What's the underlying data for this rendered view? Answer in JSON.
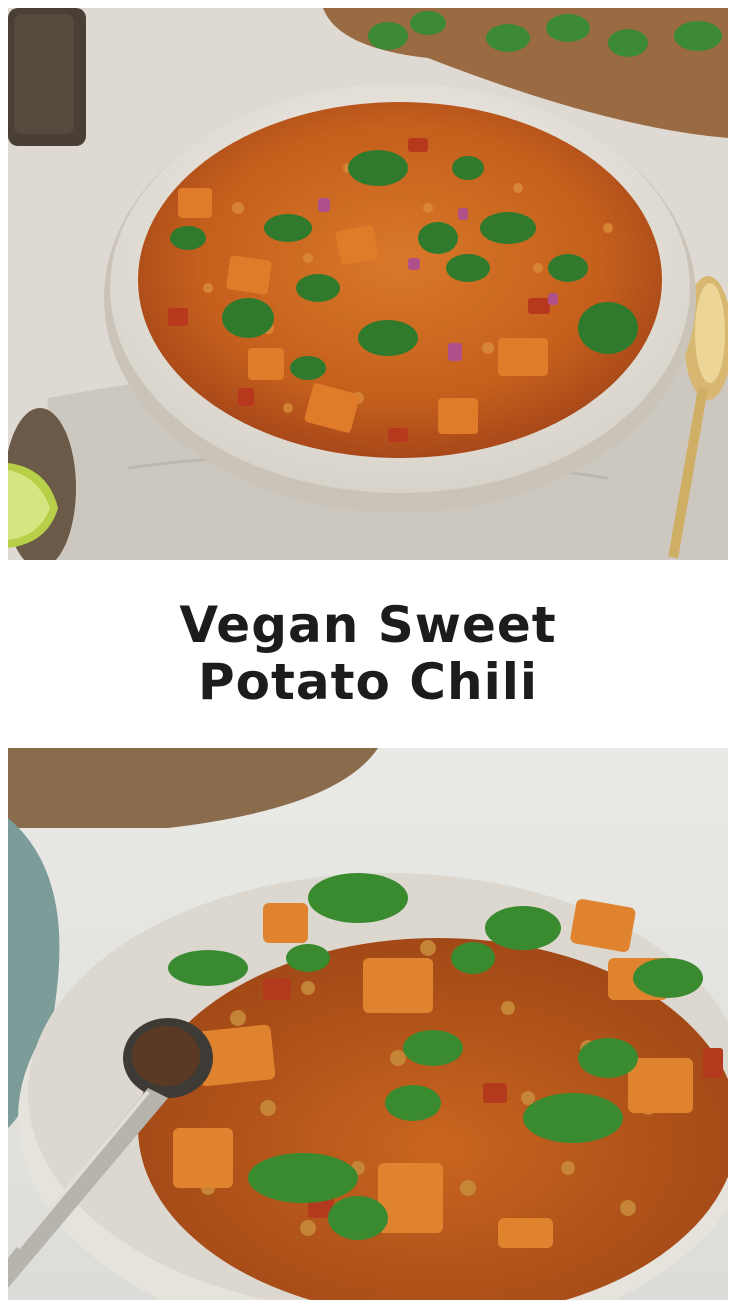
{
  "title": {
    "line1": "Vegan Sweet",
    "line2": "Potato Chili"
  },
  "colors": {
    "background": "#ffffff",
    "title_text": "#1c1c1c",
    "chili": "#c8631e",
    "cilantro": "#2f7a2c",
    "bowl": "#ece8e0"
  },
  "images": {
    "top": "overhead-chili-bowl-photo",
    "bottom": "side-angle-chili-bowl-photo"
  }
}
